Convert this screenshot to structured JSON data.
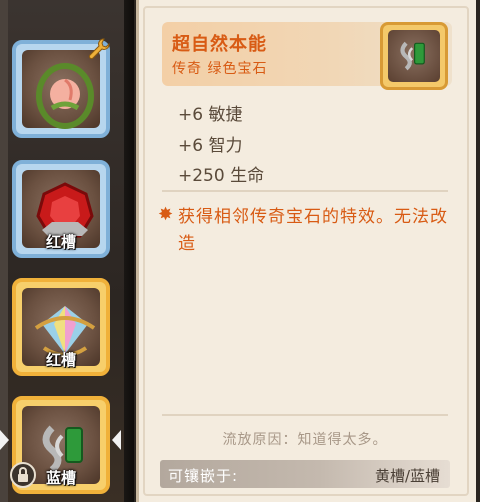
{
  "sidebar": {
    "slots": [
      {
        "label": "",
        "frame": "blue",
        "gem": "peach-icon",
        "badge": "wrench-icon"
      },
      {
        "label": "红槽",
        "frame": "blue",
        "gem": "red-gem-icon"
      },
      {
        "label": "红槽",
        "frame": "gold",
        "gem": "rainbow-gem-icon"
      },
      {
        "label": "蓝槽",
        "frame": "gold",
        "gem": "green-gem-icon",
        "selected": true
      }
    ]
  },
  "item": {
    "name": "超自然本能",
    "rarity_type": "传奇 绿色宝石",
    "icon": "green-gem-icon",
    "stats": [
      "+6 敏捷",
      "+6 智力",
      "+250 生命"
    ],
    "effect": "获得相邻传奇宝石的特效。无法改造",
    "exile_reason": "流放原因：知道得太多。",
    "socket_label": "可镶嵌于:",
    "socket_value": "黄槽/蓝槽"
  },
  "colors": {
    "accent": "#d85b14",
    "blue_frame": "#7fb0d8",
    "gold_frame": "#f0b13a",
    "panel_bg": "#f4ecdf"
  }
}
